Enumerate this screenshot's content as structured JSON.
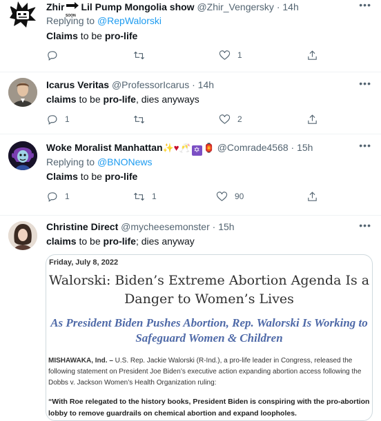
{
  "tweets": [
    {
      "name": "Zhir",
      "name_suffix": "Lil Pump Mongolia show",
      "soon_badge": "SOON",
      "handle": "@Zhir_Vengersky",
      "time": "14h",
      "replying_prefix": "Replying to ",
      "replying_to": "@RepWalorski",
      "text_parts": [
        "Claims",
        " to be ",
        "pro-life"
      ],
      "reply_count": "",
      "retweet_count": "",
      "like_count": "1"
    },
    {
      "name": "Icarus Veritas",
      "handle": "@ProfessorIcarus",
      "time": "14h",
      "text_parts": [
        "claims",
        " to be ",
        "pro-life",
        ", dies anyways"
      ],
      "reply_count": "1",
      "retweet_count": "",
      "like_count": "2"
    },
    {
      "name": "Woke Moralist Manhattan",
      "name_emojis": "✨♥🥂✡🏮",
      "handle": "@Comrade4568",
      "time": "15h",
      "replying_prefix": "Replying to ",
      "replying_to": "@BNONews",
      "text_parts": [
        "Claims",
        " to be ",
        "pro-life"
      ],
      "reply_count": "1",
      "retweet_count": "1",
      "like_count": "90"
    },
    {
      "name": "Christine Direct",
      "handle": "@mycheesemonster",
      "time": "15h",
      "text_parts": [
        "claims",
        " to be ",
        "pro-life",
        "; dies anyway"
      ]
    }
  ],
  "card": {
    "date": "Friday, July 8, 2022",
    "headline": "Walorski: Biden’s Extreme Abortion Agenda Is a Danger to Women’s Lives",
    "subheadline": "As President Biden Pushes Abortion, Rep. Walorski Is Working to Safeguard Women & Children",
    "dateline": "MISHAWAKA, Ind. –",
    "paragraph": " U.S. Rep. Jackie Walorski (R-Ind.), a pro-life leader in Congress, released the following statement on President Joe Biden’s executive action expanding abortion access following the Dobbs v. Jackson Women’s Health Organization ruling:",
    "quote": "“With Roe relegated to the history books, President Biden is conspiring with the pro-abortion lobby to remove guardrails on chemical abortion and expand loopholes."
  },
  "colors": {
    "link": "#1d9bf0",
    "secondary": "#536471",
    "heart_red": "#c8102e",
    "subhead_blue": "#4f6aa8"
  },
  "icons": [
    "reply-icon",
    "retweet-icon",
    "like-icon",
    "share-icon",
    "more-icon"
  ]
}
